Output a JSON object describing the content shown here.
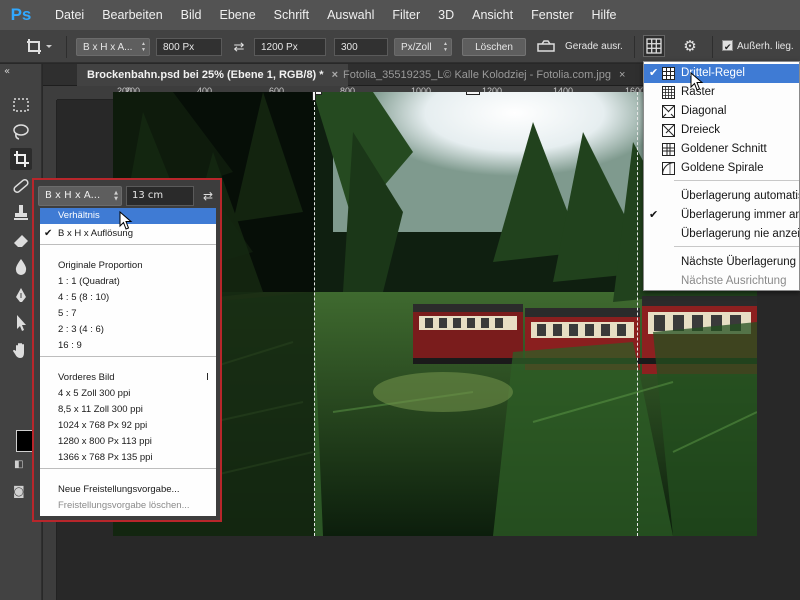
{
  "app": {
    "logo": "Ps"
  },
  "menubar": [
    "Datei",
    "Bearbeiten",
    "Bild",
    "Ebene",
    "Schrift",
    "Auswahl",
    "Filter",
    "3D",
    "Ansicht",
    "Fenster",
    "Hilfe"
  ],
  "options": {
    "ratio_preset": "B x H x A...",
    "width": "800 Px",
    "height": "1200 Px",
    "resolution": "300",
    "resolution_unit": "Px/Zoll",
    "clear_label": "Löschen",
    "straighten_label": "Gerade ausr.",
    "delete_cropped_label": "Außerh. lieg."
  },
  "tabs": [
    {
      "label": "Brockenbahn.psd bei 25% (Ebene 1, RGB/8) *",
      "close": "×"
    },
    {
      "label": "Fotolia_35519235_L© Kalle Kolodziej - Fotolia.com.jpg",
      "close": "×"
    }
  ],
  "ruler": {
    "h_labels": [
      "200",
      "0",
      "200",
      "400",
      "600",
      "800",
      "1000",
      "1200",
      "1400",
      "1600"
    ]
  },
  "ratio_popup": {
    "preset": "B x H x A...",
    "field_value": "13 cm",
    "items": [
      {
        "label": "Verhältnis",
        "highlight": true
      },
      {
        "label": "B x H x Auflösung",
        "checked": true
      },
      {
        "label": "Originale Proportion"
      },
      {
        "label": "1 : 1 (Quadrat)"
      },
      {
        "label": "4 : 5 (8 : 10)"
      },
      {
        "label": "5 : 7"
      },
      {
        "label": "2 : 3 (4 : 6)"
      },
      {
        "label": "16 : 9"
      },
      {
        "label": "Vorderes Bild"
      },
      {
        "label": "4 x 5 Zoll 300 ppi"
      },
      {
        "label": "8,5 x 11 Zoll 300 ppi"
      },
      {
        "label": "1024 x 768 Px 92 ppi"
      },
      {
        "label": "1280 x 800 Px 113 ppi"
      },
      {
        "label": "1366 x 768 Px 135 ppi"
      },
      {
        "label": "Neue Freistellungsvorgabe..."
      },
      {
        "label": "Freistellungsvorgabe löschen...",
        "disabled": true
      }
    ],
    "side_marker": "I"
  },
  "overlay_menu": {
    "items": [
      {
        "label": "Drittel-Regel",
        "checked": true,
        "highlight": true,
        "icon": "grid-thirds-icon"
      },
      {
        "label": "Raster",
        "icon": "grid-icon"
      },
      {
        "label": "Diagonal",
        "icon": "diagonal-icon"
      },
      {
        "label": "Dreieck",
        "icon": "triangle-icon"
      },
      {
        "label": "Goldener Schnitt",
        "icon": "golden-ratio-icon"
      },
      {
        "label": "Goldene Spirale",
        "icon": "golden-spiral-icon"
      },
      {
        "label": "Überlagerung automatisch"
      },
      {
        "label": "Überlagerung immer anzeigen",
        "checked": true
      },
      {
        "label": "Überlagerung nie anzeigen"
      },
      {
        "label": "Nächste Überlagerung"
      },
      {
        "label": "Nächste Ausrichtung",
        "disabled": true
      }
    ]
  },
  "colors": {
    "highlight": "#3f7bd4",
    "popup_border": "#b8262b",
    "ps_blue": "#31a8ff"
  }
}
